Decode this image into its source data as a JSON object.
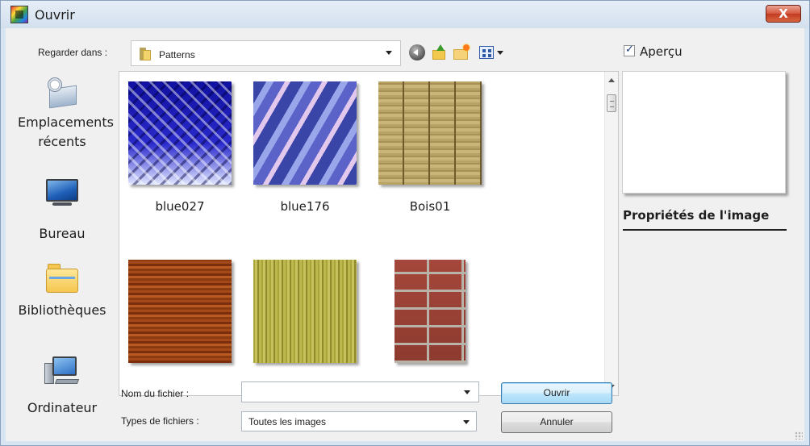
{
  "window": {
    "title": "Ouvrir",
    "close_label": "X"
  },
  "toolbar": {
    "look_in_label": "Regarder dans :",
    "look_in_value": "Patterns"
  },
  "places": [
    {
      "label": "Emplacements récents",
      "icon": "recent-places-icon"
    },
    {
      "label": "Bureau",
      "icon": "desktop-icon"
    },
    {
      "label": "Bibliothèques",
      "icon": "libraries-icon"
    },
    {
      "label": "Ordinateur",
      "icon": "computer-icon"
    }
  ],
  "files": [
    {
      "name": "blue027"
    },
    {
      "name": "blue176"
    },
    {
      "name": "Bois01"
    },
    {
      "name": ""
    },
    {
      "name": ""
    },
    {
      "name": ""
    }
  ],
  "preview": {
    "label": "Aperçu",
    "checked": true,
    "properties_title": "Propriétés de l'image"
  },
  "footer": {
    "filename_label": "Nom du fichier :",
    "filename_value": "",
    "filetype_label": "Types de fichiers :",
    "filetype_value": "Toutes les images",
    "open_label": "Ouvrir",
    "cancel_label": "Annuler"
  },
  "colors": {
    "titlebar": "#d3e0ee",
    "close": "#c23b22",
    "panel": "#f0f0f0"
  }
}
